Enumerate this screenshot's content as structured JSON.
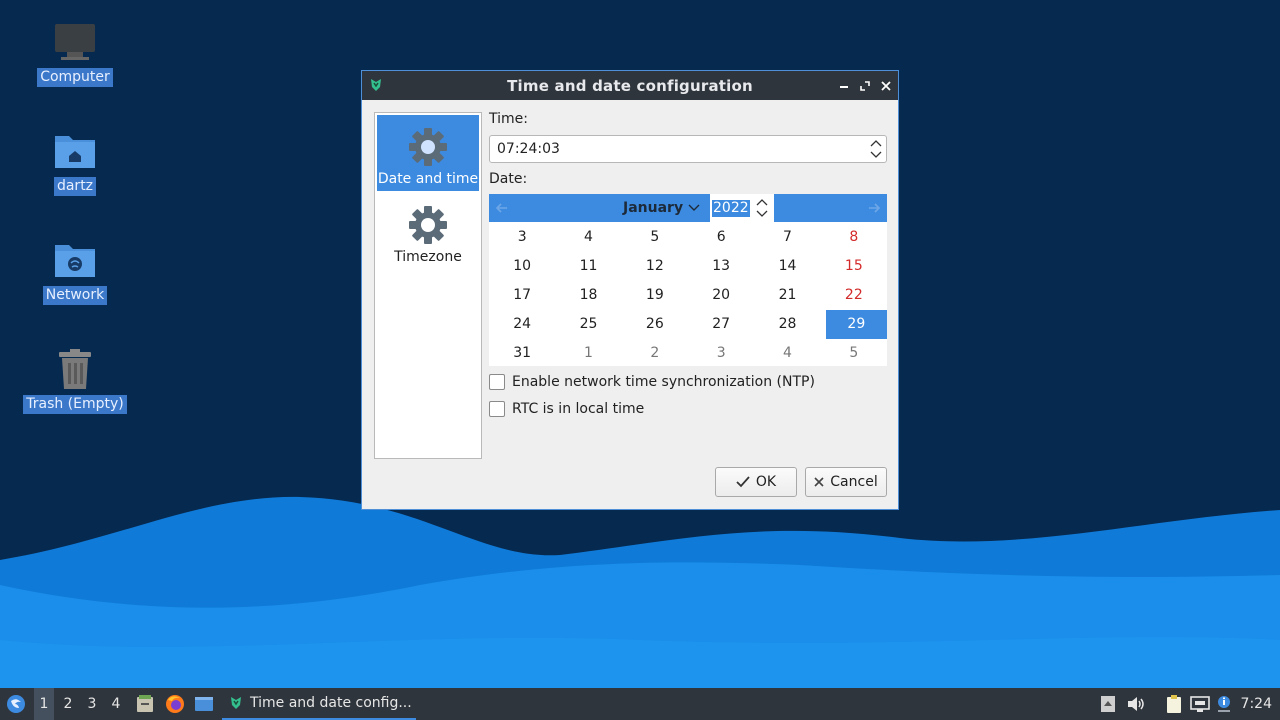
{
  "desktop": {
    "icons": [
      {
        "label": "Computer",
        "icon": "computer-icon"
      },
      {
        "label": "dartz",
        "icon": "home-folder-icon"
      },
      {
        "label": "Network",
        "icon": "network-folder-icon"
      },
      {
        "label": "Trash (Empty)",
        "icon": "trash-icon"
      }
    ]
  },
  "dialog": {
    "title": "Time and date configuration",
    "sidebar": [
      {
        "label": "Date and time",
        "icon": "gear-icon",
        "active": true
      },
      {
        "label": "Timezone",
        "icon": "gear-icon",
        "active": false
      }
    ],
    "time_label": "Time:",
    "time_value": "07:24:03",
    "date_label": "Date:",
    "calendar": {
      "month": "January",
      "year": "2022",
      "selected": "29",
      "weeks": [
        [
          "3",
          "4",
          "5",
          "6",
          "7",
          "8"
        ],
        [
          "10",
          "11",
          "12",
          "13",
          "14",
          "15"
        ],
        [
          "17",
          "18",
          "19",
          "20",
          "21",
          "22"
        ],
        [
          "24",
          "25",
          "26",
          "27",
          "28",
          "29"
        ],
        [
          "31",
          "1",
          "2",
          "3",
          "4",
          "5"
        ]
      ]
    },
    "ntp_label": "Enable network time synchronization (NTP)",
    "ntp_checked": false,
    "rtc_label": "RTC is in local time",
    "rtc_checked": false,
    "ok_label": "OK",
    "cancel_label": "Cancel"
  },
  "taskbar": {
    "workspaces": [
      "1",
      "2",
      "3",
      "4"
    ],
    "active_workspace": "1",
    "task_label": "Time and date config...",
    "clock": "7:24"
  },
  "colors": {
    "accent": "#3d8be0",
    "titlebar": "#2f353c",
    "desktop_bg": "#06294f",
    "weekend": "#d32a2a"
  }
}
